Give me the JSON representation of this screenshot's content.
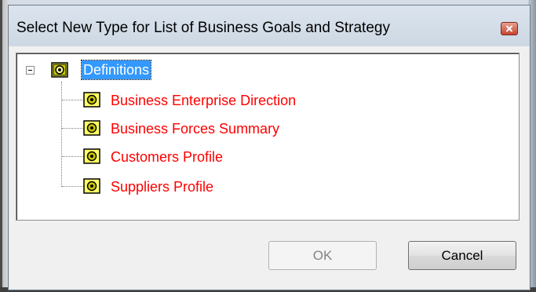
{
  "dialog": {
    "title": "Select New Type for List of Business Goals and Strategy"
  },
  "tree": {
    "root": {
      "label": "Definitions",
      "expanded": true,
      "selected": true,
      "icon": "folder-definition-icon"
    },
    "children": [
      {
        "label": "Business Enterprise Direction",
        "icon": "definition-icon"
      },
      {
        "label": "Business Forces Summary",
        "icon": "definition-icon"
      },
      {
        "label": "Customers Profile",
        "icon": "definition-icon"
      },
      {
        "label": "Suppliers Profile",
        "icon": "definition-icon"
      }
    ]
  },
  "buttons": {
    "ok": "OK",
    "ok_enabled": false,
    "cancel": "Cancel"
  },
  "colors": {
    "selection": "#3399ff",
    "child_text": "#ff0000",
    "close_button": "#c6452e"
  }
}
